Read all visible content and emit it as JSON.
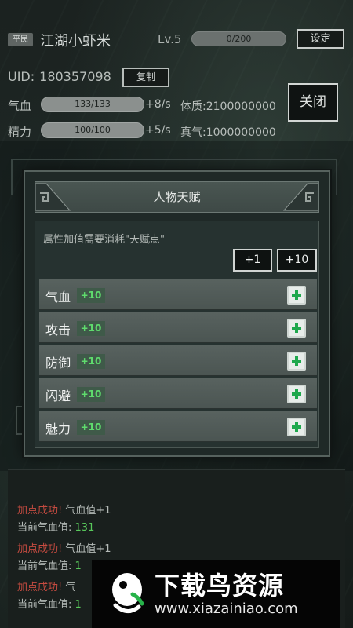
{
  "header": {
    "rank": "平民",
    "player_name": "江湖小虾米",
    "level": "Lv.5",
    "exp_text": "0/200",
    "exp_fraction": 0,
    "settings_label": "设定"
  },
  "profile": {
    "uid_label": "UID:",
    "uid_value": "180357098",
    "copy_label": "复制",
    "close_label": "关闭"
  },
  "stats": [
    {
      "label": "气血",
      "bar_text": "133/133",
      "rate": "+8/s",
      "extra": "体质:2100000000"
    },
    {
      "label": "精力",
      "bar_text": "100/100",
      "rate": "+5/s",
      "extra": "真气:1000000000"
    }
  ],
  "dialog": {
    "title": "人物天赋",
    "hint": "属性加值需要消耗\"天赋点\"",
    "inc_small": "+1",
    "inc_large": "+10",
    "attributes": [
      {
        "name": "气血",
        "bonus": "+10"
      },
      {
        "name": "攻击",
        "bonus": "+10"
      },
      {
        "name": "防御",
        "bonus": "+10"
      },
      {
        "name": "闪避",
        "bonus": "+10"
      },
      {
        "name": "魅力",
        "bonus": "+10"
      }
    ]
  },
  "log": [
    {
      "success": "加点成功!",
      "detail": "气血值+1"
    },
    {
      "label": "当前气血值:",
      "value": "131"
    },
    {
      "success": "加点成功!",
      "detail": "气血值+1"
    },
    {
      "label": "当前气血值:",
      "value": "1"
    },
    {
      "success": "加点成功!",
      "detail": "气"
    },
    {
      "label": "当前气血值:",
      "value": "1"
    }
  ],
  "watermark": {
    "title": "下载鸟资源",
    "url": "www.xiazainiao.com"
  },
  "colors": {
    "success_red": "#c54b40",
    "value_green": "#58c95b",
    "bonus_green": "#5fdc6d",
    "plus_green": "#1ea84c"
  }
}
